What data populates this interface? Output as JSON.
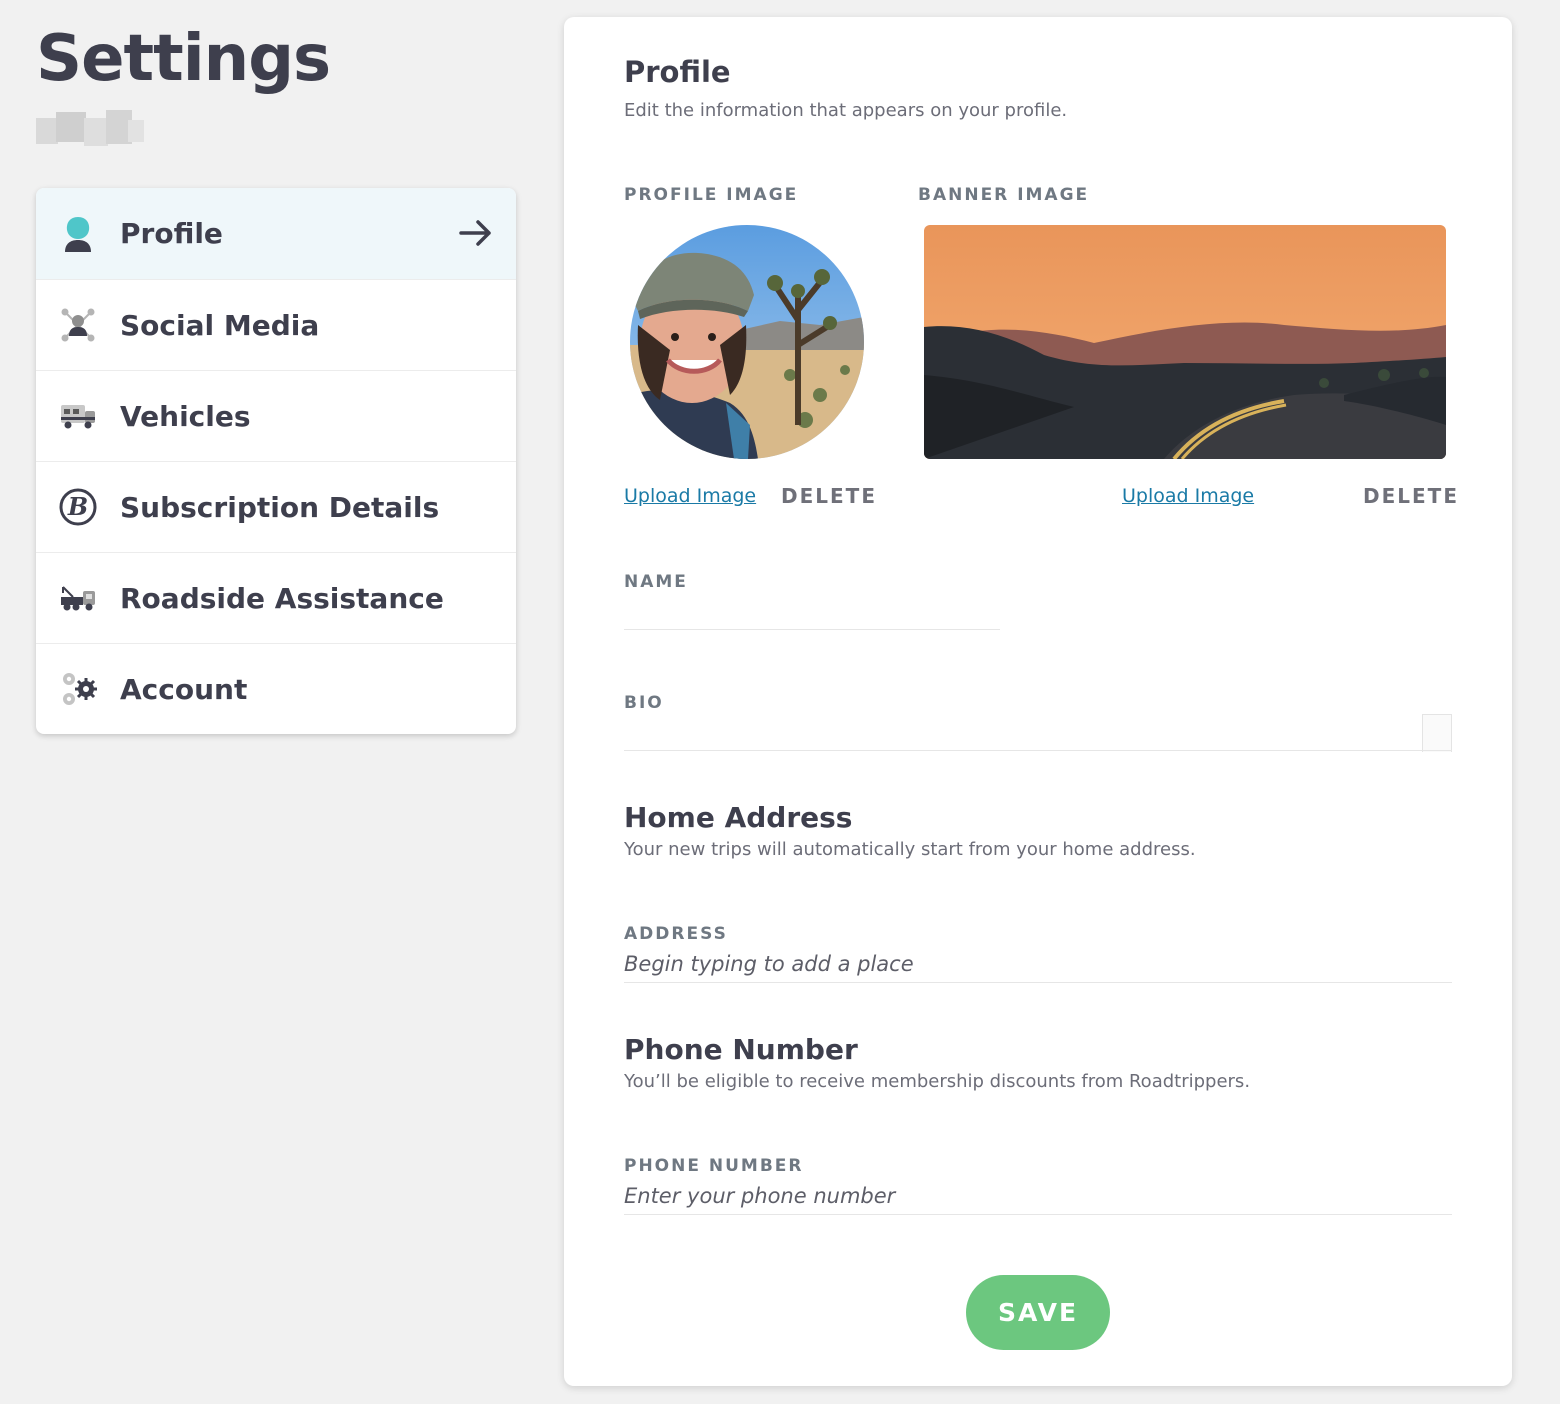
{
  "page": {
    "title": "Settings"
  },
  "sidebar": {
    "items": [
      {
        "label": "Profile",
        "icon": "profile-icon",
        "active": true
      },
      {
        "label": "Social Media",
        "icon": "social-network-icon"
      },
      {
        "label": "Vehicles",
        "icon": "rv-icon"
      },
      {
        "label": "Subscription Details",
        "icon": "roadtrippers-b-icon"
      },
      {
        "label": "Roadside Assistance",
        "icon": "tow-truck-icon"
      },
      {
        "label": "Account",
        "icon": "gears-icon"
      }
    ],
    "active_icon_color": "#4fc6c9"
  },
  "profile": {
    "title": "Profile",
    "subtitle": "Edit the information that appears on your profile.",
    "profile_image_label": "PROFILE IMAGE",
    "banner_image_label": "BANNER IMAGE",
    "upload_label": "Upload Image",
    "delete_label": "DELETE",
    "name_label": "NAME",
    "name_value": "",
    "bio_label": "BIO",
    "bio_value": ""
  },
  "home_address": {
    "title": "Home Address",
    "subtitle": "Your new trips will automatically start from your home address.",
    "address_label": "ADDRESS",
    "address_placeholder": "Begin typing to add a place"
  },
  "phone": {
    "title": "Phone Number",
    "subtitle": "You’ll be eligible to receive membership discounts from Roadtrippers.",
    "phone_label": "PHONE NUMBER",
    "phone_placeholder": "Enter your phone number"
  },
  "actions": {
    "save_label": "SAVE",
    "save_color": "#6cc77f",
    "link_color": "#1a7aa6"
  }
}
